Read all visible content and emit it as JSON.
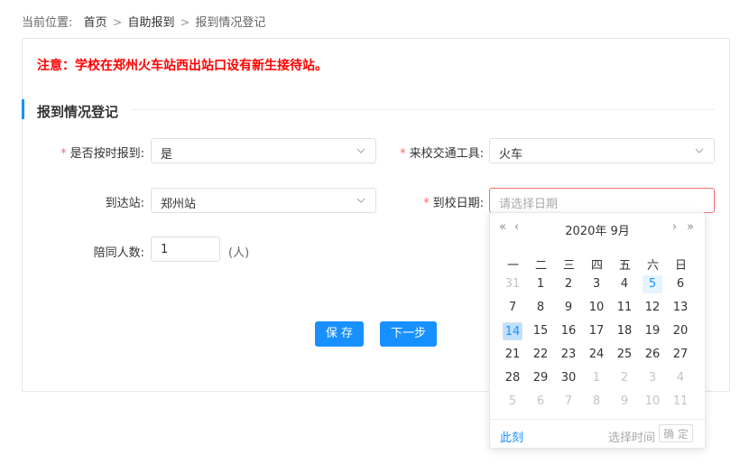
{
  "breadcrumb": {
    "prefix": "当前位置:",
    "home": "首页",
    "sep": ">",
    "step": "自助报到",
    "current": "报到情况登记"
  },
  "notice": "注意：学校在郑州火车站西出站口设有新生接待站。",
  "section_title": "报到情况登记",
  "form": {
    "ontime": {
      "label": "是否按时报到:",
      "value": "是"
    },
    "transport": {
      "label": "来校交通工具:",
      "value": "火车"
    },
    "station": {
      "label": "到达站:",
      "value": "郑州站"
    },
    "date": {
      "label": "到校日期:",
      "placeholder": "请选择日期"
    },
    "companions": {
      "label": "陪同人数:",
      "value": "1",
      "unit": "(人)"
    }
  },
  "buttons": {
    "save": "保 存",
    "next": "下一步"
  },
  "calendar": {
    "title": "2020年 9月",
    "weekdays": [
      "一",
      "二",
      "三",
      "四",
      "五",
      "六",
      "日"
    ],
    "days": [
      [
        "31",
        "1",
        "2",
        "3",
        "4",
        "5",
        "6"
      ],
      [
        "7",
        "8",
        "9",
        "10",
        "11",
        "12",
        "13"
      ],
      [
        "14",
        "15",
        "16",
        "17",
        "18",
        "19",
        "20"
      ],
      [
        "21",
        "22",
        "23",
        "24",
        "25",
        "26",
        "27"
      ],
      [
        "28",
        "29",
        "30",
        "1",
        "2",
        "3",
        "4"
      ],
      [
        "5",
        "6",
        "7",
        "8",
        "9",
        "10",
        "11"
      ]
    ],
    "now_label": "此刻",
    "select_time_label": "选择时间",
    "ok_label": "确 定"
  },
  "colors": {
    "accent": "#1890ff",
    "notice": "#ff0000",
    "required": "#f56c6c"
  }
}
